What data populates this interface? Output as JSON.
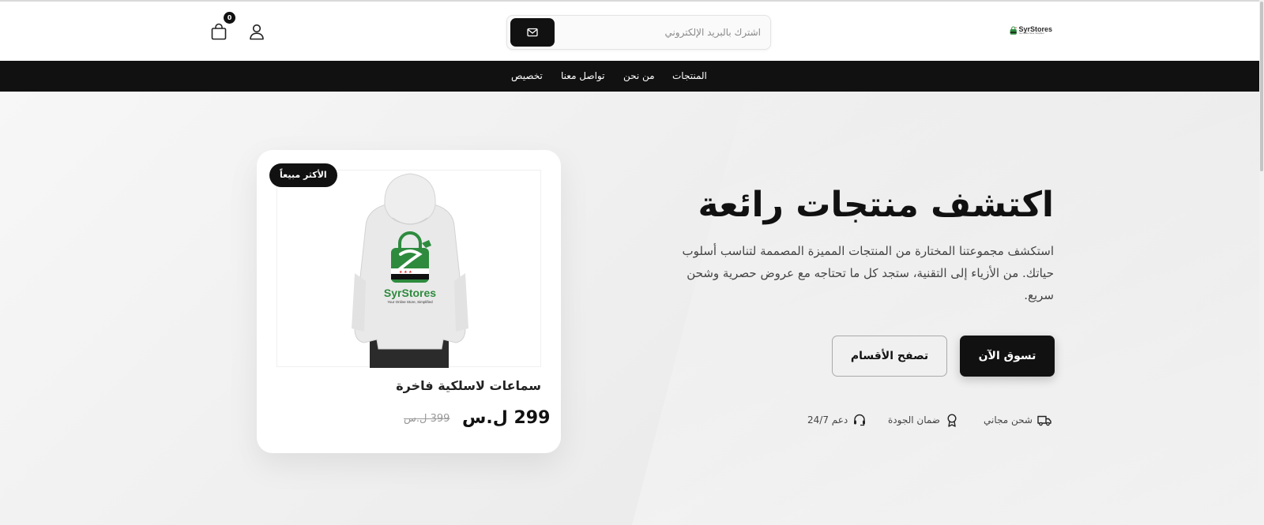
{
  "header": {
    "logo": {
      "name": "SyrStores",
      "tagline": "Your Online Store, Simplified"
    },
    "newsletter": {
      "placeholder": "اشترك بالبريد الإلكتروني"
    },
    "cart": {
      "count": "0"
    }
  },
  "nav": {
    "items": [
      {
        "label": "المنتجات"
      },
      {
        "label": "من نحن"
      },
      {
        "label": "تواصل معنا"
      },
      {
        "label": "تخصيص"
      }
    ]
  },
  "hero": {
    "title": "اكتشف منتجات رائعة",
    "description": "استكشف مجموعتنا المختارة من المنتجات المميزة المصممة لتناسب أسلوب حياتك. من الأزياء إلى التقنية، ستجد كل ما تحتاجه مع عروض حصرية وشحن سريع.",
    "primary_button": "تسوق الآن",
    "secondary_button": "تصفح الأقسام",
    "features": [
      {
        "label": "شحن مجاني",
        "icon": "truck-icon"
      },
      {
        "label": "ضمان الجودة",
        "icon": "award-icon"
      },
      {
        "label": "دعم 24/7",
        "icon": "headset-icon"
      }
    ]
  },
  "product_card": {
    "badge": "الأكثر مبيعاً",
    "name": "سماعات لاسلكية فاخرة",
    "price": "299 ل.س",
    "old_price": "399 ل.س",
    "image_logo": {
      "name": "SyrStores",
      "tagline": "Your Online Store, Simplified"
    }
  },
  "colors": {
    "primary": "#111111",
    "brand_green": "#2e8b3e",
    "background": "#f2f2f2"
  }
}
